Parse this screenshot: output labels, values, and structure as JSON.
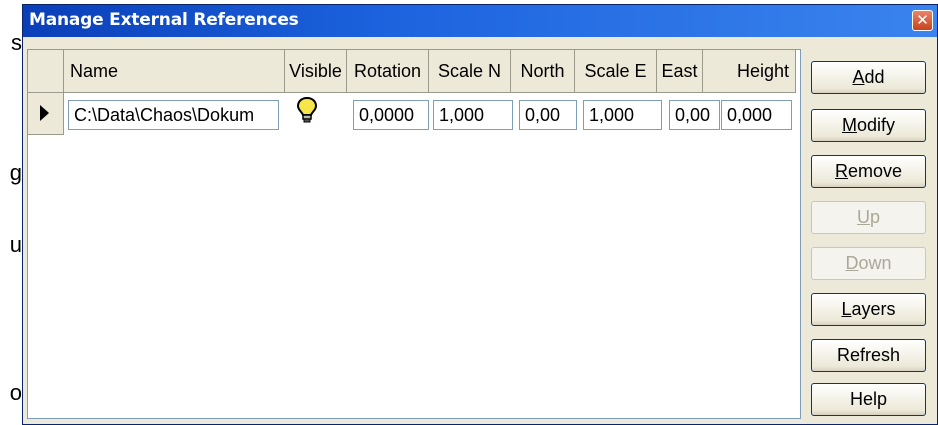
{
  "background_fragments": [
    "s",
    "g",
    "u",
    "o"
  ],
  "dialog": {
    "title": "Manage External References",
    "close_glyph": "✕"
  },
  "grid": {
    "columns": [
      "Name",
      "Visible",
      "Rotation",
      "Scale N",
      "North",
      "Scale E",
      "East",
      "Height"
    ],
    "rows": [
      {
        "name": "C:\\Data\\Chaos\\Dokum",
        "visible_icon": "lightbulb-icon",
        "rotation": "0,0000",
        "scale_n": "1,000",
        "north": "0,00",
        "scale_e": "1,000",
        "east": "0,00",
        "height": "0,000"
      }
    ]
  },
  "buttons": {
    "add": {
      "first": "A",
      "rest": "dd"
    },
    "modify": {
      "first": "M",
      "rest": "odify"
    },
    "remove": {
      "first": "R",
      "rest": "emove"
    },
    "up": {
      "first": "U",
      "rest": "p"
    },
    "down": {
      "first": "D",
      "rest": "own"
    },
    "layers": {
      "first": "L",
      "rest": "ayers"
    },
    "refresh": "Refresh",
    "help": "Help"
  },
  "colors": {
    "title_bar": "#0a3fb8",
    "dialog_face": "#ece9d8",
    "field_border": "#7f9db9",
    "bulb": "#f6e64a"
  }
}
